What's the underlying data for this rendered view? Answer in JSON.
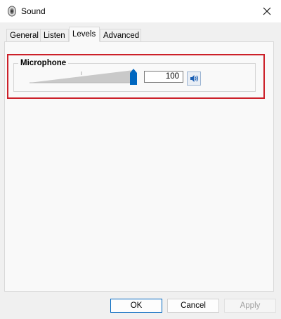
{
  "window": {
    "title": "Sound",
    "icon": "speaker-icon"
  },
  "tabs": [
    {
      "label": "General",
      "active": false
    },
    {
      "label": "Listen",
      "active": false
    },
    {
      "label": "Levels",
      "active": true
    },
    {
      "label": "Advanced",
      "active": false
    }
  ],
  "levels": {
    "group_label": "Microphone",
    "slider_value": 100,
    "slider_max": 100,
    "value_text": "100",
    "speaker_button_icon": "speaker-volume-icon"
  },
  "buttons": {
    "ok": "OK",
    "cancel": "Cancel",
    "apply": "Apply"
  },
  "colors": {
    "highlight": "#cc2029",
    "accent": "#0067c0"
  }
}
